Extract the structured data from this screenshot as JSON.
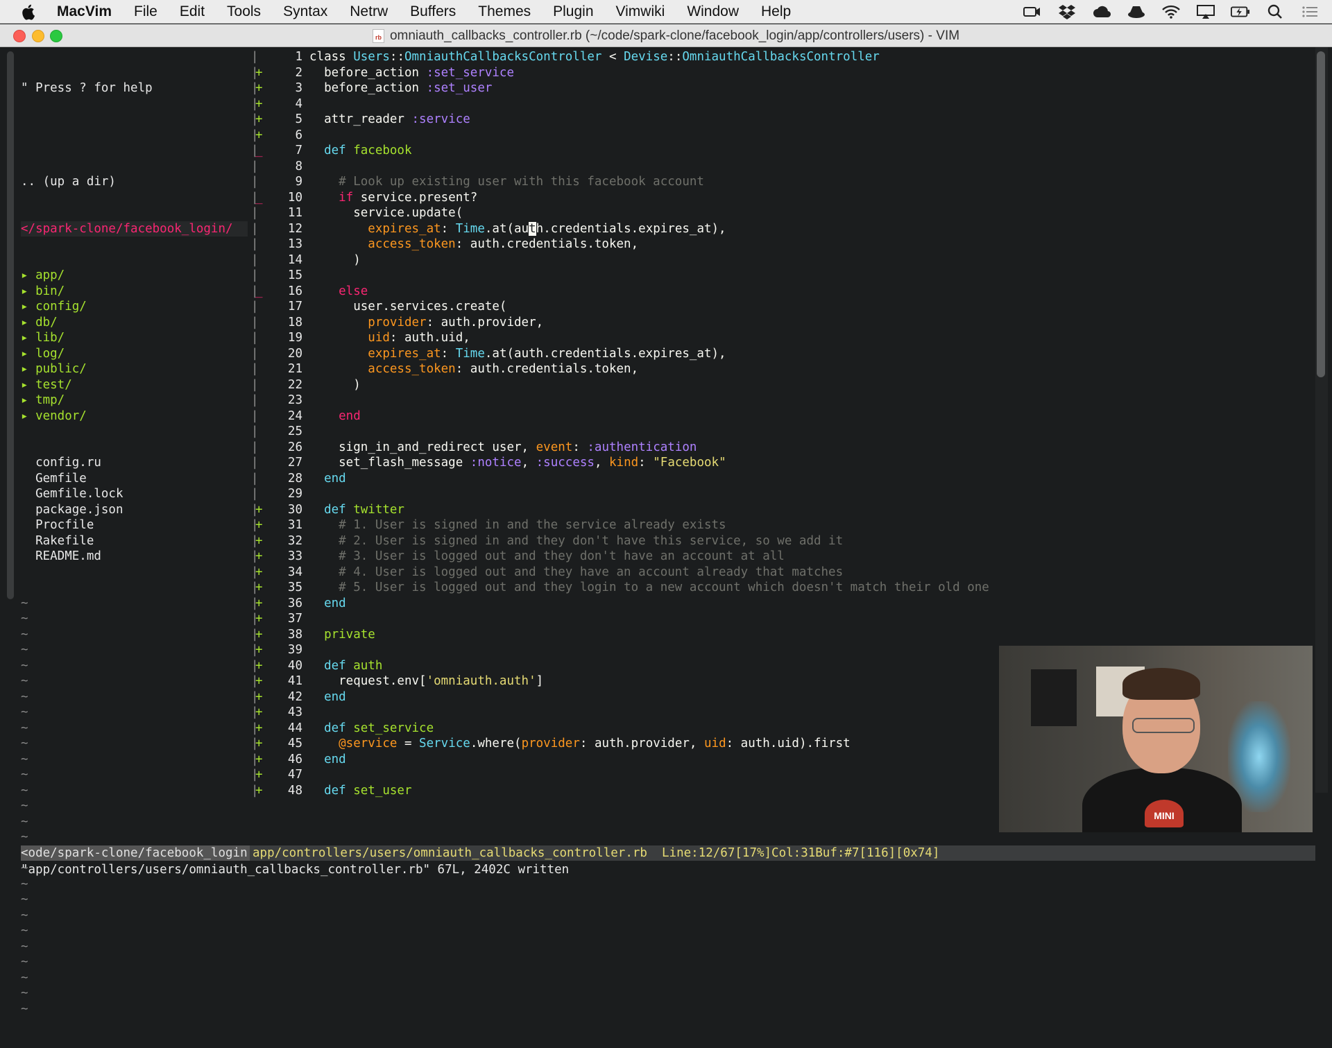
{
  "menubar": {
    "app": "MacVim",
    "items": [
      "File",
      "Edit",
      "Tools",
      "Syntax",
      "Netrw",
      "Buffers",
      "Themes",
      "Plugin",
      "Vimwiki",
      "Window",
      "Help"
    ],
    "tray_icons": [
      "camera-icon",
      "dropbox-icon",
      "cloud-icon",
      "incognito-icon",
      "wifi-icon",
      "airplay-icon",
      "battery-icon",
      "search-icon",
      "list-icon"
    ]
  },
  "window": {
    "title": "omniauth_callbacks_controller.rb (~/code/spark-clone/facebook_login/app/controllers/users) - VIM",
    "file_icon_text": "rb"
  },
  "tree": {
    "help": "\" Press ? for help",
    "updir": ".. (up a dir)",
    "cwd": "</spark-clone/facebook_login/",
    "dirs": [
      "app/",
      "bin/",
      "config/",
      "db/",
      "lib/",
      "log/",
      "public/",
      "test/",
      "tmp/",
      "vendor/"
    ],
    "files": [
      "config.ru",
      "Gemfile",
      "Gemfile.lock",
      "package.json",
      "Procfile",
      "Rakefile",
      "README.md"
    ],
    "tilde": "~"
  },
  "code": {
    "lines": [
      {
        "n": "1",
        "s": "",
        "t": [
          [
            "class ",
            "src"
          ],
          [
            "Users",
            "cls"
          ],
          [
            "::",
            "src"
          ],
          [
            "OmniauthCallbacksController",
            "cls"
          ],
          [
            " < ",
            "src"
          ],
          [
            "Devise",
            "cls"
          ],
          [
            "::",
            "src"
          ],
          [
            "OmniauthCallbacksController",
            "cls"
          ]
        ]
      },
      {
        "n": "2",
        "s": "+",
        "t": [
          [
            "  before_action ",
            "src"
          ],
          [
            ":set_service",
            "sym"
          ]
        ]
      },
      {
        "n": "3",
        "s": "+",
        "t": [
          [
            "  before_action ",
            "src"
          ],
          [
            ":set_user",
            "sym"
          ]
        ]
      },
      {
        "n": "4",
        "s": "+",
        "t": []
      },
      {
        "n": "5",
        "s": "+",
        "t": [
          [
            "  attr_reader ",
            "src"
          ],
          [
            ":service",
            "sym"
          ]
        ]
      },
      {
        "n": "6",
        "s": "+",
        "t": []
      },
      {
        "n": "7",
        "s": "_",
        "t": [
          [
            "  def ",
            "cls"
          ],
          [
            "facebook",
            "fn"
          ]
        ]
      },
      {
        "n": "8",
        "s": "",
        "t": []
      },
      {
        "n": "9",
        "s": "",
        "t": [
          [
            "    # Look up existing user with this facebook account",
            "cmt"
          ]
        ]
      },
      {
        "n": "10",
        "s": "_",
        "t": [
          [
            "    if ",
            "kw"
          ],
          [
            "service.present?",
            "src"
          ]
        ]
      },
      {
        "n": "11",
        "s": "",
        "t": [
          [
            "      service.update(",
            "src"
          ]
        ]
      },
      {
        "n": "12",
        "s": "",
        "t": [
          [
            "        expires_at",
            "key"
          ],
          [
            ": ",
            "src"
          ],
          [
            "Time",
            "cls"
          ],
          [
            ".at(au",
            "src"
          ],
          [
            "t",
            "cursor"
          ],
          [
            "h.credentials.expires_at),",
            "src"
          ]
        ]
      },
      {
        "n": "13",
        "s": "",
        "t": [
          [
            "        access_token",
            "key"
          ],
          [
            ": auth.credentials.token,",
            "src"
          ]
        ]
      },
      {
        "n": "14",
        "s": "",
        "t": [
          [
            "      )",
            "src"
          ]
        ]
      },
      {
        "n": "15",
        "s": "",
        "t": []
      },
      {
        "n": "16",
        "s": "_",
        "t": [
          [
            "    else",
            "kw"
          ]
        ]
      },
      {
        "n": "17",
        "s": "",
        "t": [
          [
            "      user.services.create(",
            "src"
          ]
        ]
      },
      {
        "n": "18",
        "s": "",
        "t": [
          [
            "        provider",
            "key"
          ],
          [
            ": auth.provider,",
            "src"
          ]
        ]
      },
      {
        "n": "19",
        "s": "",
        "t": [
          [
            "        uid",
            "key"
          ],
          [
            ": auth.uid,",
            "src"
          ]
        ]
      },
      {
        "n": "20",
        "s": "",
        "t": [
          [
            "        expires_at",
            "key"
          ],
          [
            ": ",
            "src"
          ],
          [
            "Time",
            "cls"
          ],
          [
            ".at(auth.credentials.expires_at),",
            "src"
          ]
        ]
      },
      {
        "n": "21",
        "s": "",
        "t": [
          [
            "        access_token",
            "key"
          ],
          [
            ": auth.credentials.token,",
            "src"
          ]
        ]
      },
      {
        "n": "22",
        "s": "",
        "t": [
          [
            "      )",
            "src"
          ]
        ]
      },
      {
        "n": "23",
        "s": "",
        "t": []
      },
      {
        "n": "24",
        "s": "",
        "t": [
          [
            "    end",
            "kw"
          ]
        ]
      },
      {
        "n": "25",
        "s": "",
        "t": []
      },
      {
        "n": "26",
        "s": "",
        "t": [
          [
            "    sign_in_and_redirect user, ",
            "src"
          ],
          [
            "event",
            "key"
          ],
          [
            ": ",
            "src"
          ],
          [
            ":authentication",
            "sym"
          ]
        ]
      },
      {
        "n": "27",
        "s": "",
        "t": [
          [
            "    set_flash_message ",
            "src"
          ],
          [
            ":notice",
            "sym"
          ],
          [
            ", ",
            "src"
          ],
          [
            ":success",
            "sym"
          ],
          [
            ", ",
            "src"
          ],
          [
            "kind",
            "key"
          ],
          [
            ": ",
            "src"
          ],
          [
            "\"Facebook\"",
            "str"
          ]
        ]
      },
      {
        "n": "28",
        "s": "",
        "t": [
          [
            "  end",
            "cls"
          ]
        ]
      },
      {
        "n": "29",
        "s": "",
        "t": []
      },
      {
        "n": "30",
        "s": "+",
        "t": [
          [
            "  def ",
            "cls"
          ],
          [
            "twitter",
            "fn"
          ]
        ]
      },
      {
        "n": "31",
        "s": "+",
        "t": [
          [
            "    # 1. User is signed in and the service already exists",
            "cmt"
          ]
        ]
      },
      {
        "n": "32",
        "s": "+",
        "t": [
          [
            "    # 2. User is signed in and they don't have this service, so we add it",
            "cmt"
          ]
        ]
      },
      {
        "n": "33",
        "s": "+",
        "t": [
          [
            "    # 3. User is logged out and they don't have an account at all",
            "cmt"
          ]
        ]
      },
      {
        "n": "34",
        "s": "+",
        "t": [
          [
            "    # 4. User is logged out and they have an account already that matches",
            "cmt"
          ]
        ]
      },
      {
        "n": "35",
        "s": "+",
        "t": [
          [
            "    # 5. User is logged out and they login to a new account which doesn't match their old one",
            "cmt"
          ]
        ]
      },
      {
        "n": "36",
        "s": "+",
        "t": [
          [
            "  end",
            "cls"
          ]
        ]
      },
      {
        "n": "37",
        "s": "+",
        "t": []
      },
      {
        "n": "38",
        "s": "+",
        "t": [
          [
            "  private",
            "fn"
          ]
        ]
      },
      {
        "n": "39",
        "s": "+",
        "t": []
      },
      {
        "n": "40",
        "s": "+",
        "t": [
          [
            "  def ",
            "cls"
          ],
          [
            "auth",
            "fn"
          ]
        ]
      },
      {
        "n": "41",
        "s": "+",
        "t": [
          [
            "    request.env[",
            "src"
          ],
          [
            "'omniauth.auth'",
            "str"
          ],
          [
            "]",
            "src"
          ]
        ]
      },
      {
        "n": "42",
        "s": "+",
        "t": [
          [
            "  end",
            "cls"
          ]
        ]
      },
      {
        "n": "43",
        "s": "+",
        "t": []
      },
      {
        "n": "44",
        "s": "+",
        "t": [
          [
            "  def ",
            "cls"
          ],
          [
            "set_service",
            "fn"
          ]
        ]
      },
      {
        "n": "45",
        "s": "+",
        "t": [
          [
            "    @service",
            "ivar"
          ],
          [
            " = ",
            "src"
          ],
          [
            "Service",
            "cls"
          ],
          [
            ".where(",
            "src"
          ],
          [
            "provider",
            "key"
          ],
          [
            ": auth.provider, ",
            "src"
          ],
          [
            "uid",
            "key"
          ],
          [
            ": auth.uid).first",
            "src"
          ]
        ]
      },
      {
        "n": "46",
        "s": "+",
        "t": [
          [
            "  end",
            "cls"
          ]
        ]
      },
      {
        "n": "47",
        "s": "+",
        "t": []
      },
      {
        "n": "48",
        "s": "+",
        "t": [
          [
            "  def ",
            "cls"
          ],
          [
            "set_user",
            "fn"
          ]
        ]
      }
    ]
  },
  "statusline": {
    "left": "<ode/spark-clone/facebook_login ",
    "right": "app/controllers/users/omniauth_callbacks_controller.rb  Line:12/67[17%]Col:31Buf:#7[116][0x74]"
  },
  "cmdline": "\"app/controllers/users/omniauth_callbacks_controller.rb\" 67L, 2402C written",
  "webcam": {
    "shirt_text": "MINI"
  },
  "colors": {
    "background": "#1b1d1e",
    "keyword": "#f92672",
    "function": "#a6e22e",
    "symbol": "#ae81ff",
    "class": "#66d9ef",
    "hash_key": "#fd971f",
    "string": "#e6db74",
    "comment": "#6f706a"
  }
}
